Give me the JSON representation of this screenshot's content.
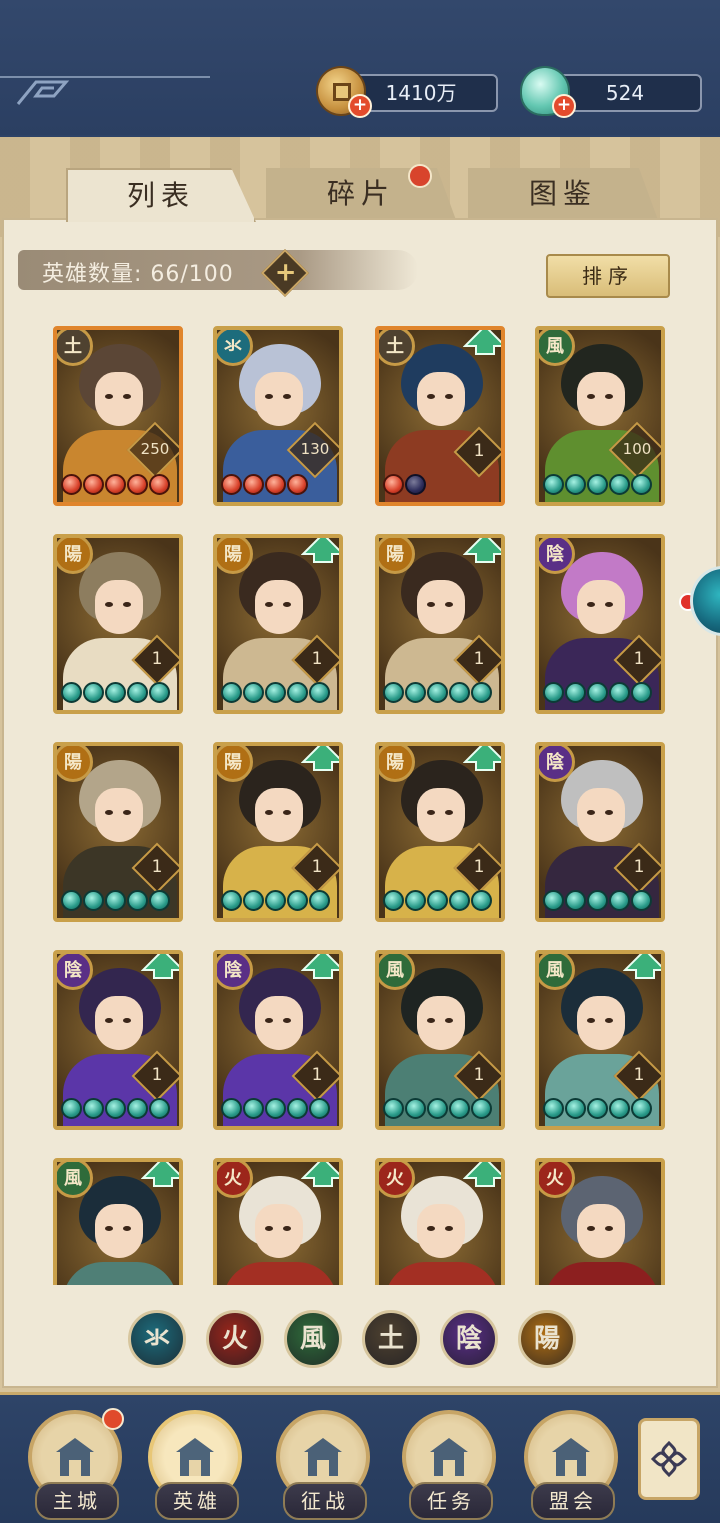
{
  "currencies": {
    "gold": "1410万",
    "jade": "524"
  },
  "tabs": [
    {
      "label": "列表",
      "active": true
    },
    {
      "label": "碎片",
      "active": false,
      "has_dot": true
    },
    {
      "label": "图鉴",
      "active": false
    }
  ],
  "hero_count_label": "英雄数量: 66/100",
  "sort_label": "排序",
  "elements": {
    "water": "氺",
    "fire": "火",
    "wind": "風",
    "earth": "土",
    "yin": "陰",
    "yang": "陽"
  },
  "heroes": [
    {
      "element": "earth",
      "level": "250",
      "stars": 5,
      "star_color": "red",
      "upgrade": false,
      "hair": "#5b4636",
      "body": "#c9862f"
    },
    {
      "element": "water",
      "level": "130",
      "stars": 4,
      "star_color": "red",
      "upgrade": false,
      "hair": "#b9c2d6",
      "body": "#3a5e9c"
    },
    {
      "element": "earth",
      "level": "1",
      "stars": 1,
      "star_color": "red",
      "star_off": 1,
      "upgrade": true,
      "hair": "#1f3c5f",
      "body": "#8d3b22"
    },
    {
      "element": "wind",
      "level": "100",
      "stars": 5,
      "star_color": "teal",
      "upgrade": false,
      "hair": "#22261f",
      "body": "#5f8f2f"
    },
    {
      "element": "yang",
      "level": "1",
      "stars": 5,
      "star_color": "teal",
      "upgrade": false,
      "hair": "#8d7d5f",
      "body": "#e8dcc2"
    },
    {
      "element": "yang",
      "level": "1",
      "stars": 5,
      "star_color": "teal",
      "upgrade": true,
      "hair": "#3a2a1f",
      "body": "#cdb891"
    },
    {
      "element": "yang",
      "level": "1",
      "stars": 5,
      "star_color": "teal",
      "upgrade": true,
      "hair": "#3a2a1f",
      "body": "#cdb891"
    },
    {
      "element": "yin",
      "level": "1",
      "stars": 5,
      "star_color": "teal",
      "upgrade": false,
      "hair": "#c27ac7",
      "body": "#3b2758"
    },
    {
      "element": "yang",
      "level": "1",
      "stars": 5,
      "star_color": "teal",
      "upgrade": false,
      "hair": "#b3a58a",
      "body": "#3c3626"
    },
    {
      "element": "yang",
      "level": "1",
      "stars": 5,
      "star_color": "teal",
      "upgrade": true,
      "hair": "#2b241d",
      "body": "#d7b24a"
    },
    {
      "element": "yang",
      "level": "1",
      "stars": 5,
      "star_color": "teal",
      "upgrade": true,
      "hair": "#2b241d",
      "body": "#d7b24a"
    },
    {
      "element": "yin",
      "level": "1",
      "stars": 5,
      "star_color": "teal",
      "upgrade": false,
      "hair": "#bfbfbf",
      "body": "#35273f"
    },
    {
      "element": "yin",
      "level": "1",
      "stars": 5,
      "star_color": "teal",
      "upgrade": true,
      "hair": "#33264f",
      "body": "#5b36a8"
    },
    {
      "element": "yin",
      "level": "1",
      "stars": 5,
      "star_color": "teal",
      "upgrade": true,
      "hair": "#33264f",
      "body": "#5b36a8"
    },
    {
      "element": "wind",
      "level": "1",
      "stars": 5,
      "star_color": "teal",
      "upgrade": false,
      "hair": "#1e2422",
      "body": "#4c7f74"
    },
    {
      "element": "wind",
      "level": "1",
      "stars": 5,
      "star_color": "teal",
      "upgrade": true,
      "hair": "#1b2d3a",
      "body": "#6aa39a"
    },
    {
      "element": "wind",
      "level": "",
      "stars": 0,
      "star_color": "teal",
      "upgrade": true,
      "hair": "#1b2d3a",
      "body": "#4f7f76"
    },
    {
      "element": "fire",
      "level": "",
      "stars": 0,
      "star_color": "teal",
      "upgrade": true,
      "hair": "#e9e3d6",
      "body": "#a32f23"
    },
    {
      "element": "fire",
      "level": "",
      "stars": 0,
      "star_color": "teal",
      "upgrade": true,
      "hair": "#e9e3d6",
      "body": "#a32f23"
    },
    {
      "element": "fire",
      "level": "",
      "stars": 0,
      "star_color": "teal",
      "upgrade": false,
      "hair": "#5c6472",
      "body": "#8c1f1f"
    }
  ],
  "element_filters": [
    "water",
    "fire",
    "wind",
    "earth",
    "yin",
    "yang"
  ],
  "element_colors": {
    "water": "#1d6c7c",
    "fire": "#9c261b",
    "wind": "#2f6b3a",
    "earth": "#4f4230",
    "yin": "#5a2f86",
    "yang": "#b06f14"
  },
  "nav": [
    {
      "label": "主城",
      "icon": "city-gate-icon",
      "active": false,
      "has_dot": true
    },
    {
      "label": "英雄",
      "icon": "hero-portrait-icon",
      "active": true
    },
    {
      "label": "征战",
      "icon": "battle-drum-icon",
      "active": false
    },
    {
      "label": "任务",
      "icon": "scroll-task-icon",
      "active": false
    },
    {
      "label": "盟会",
      "icon": "alliance-pavilion-icon",
      "active": false
    }
  ],
  "menu_icon": "flower-menu-icon"
}
